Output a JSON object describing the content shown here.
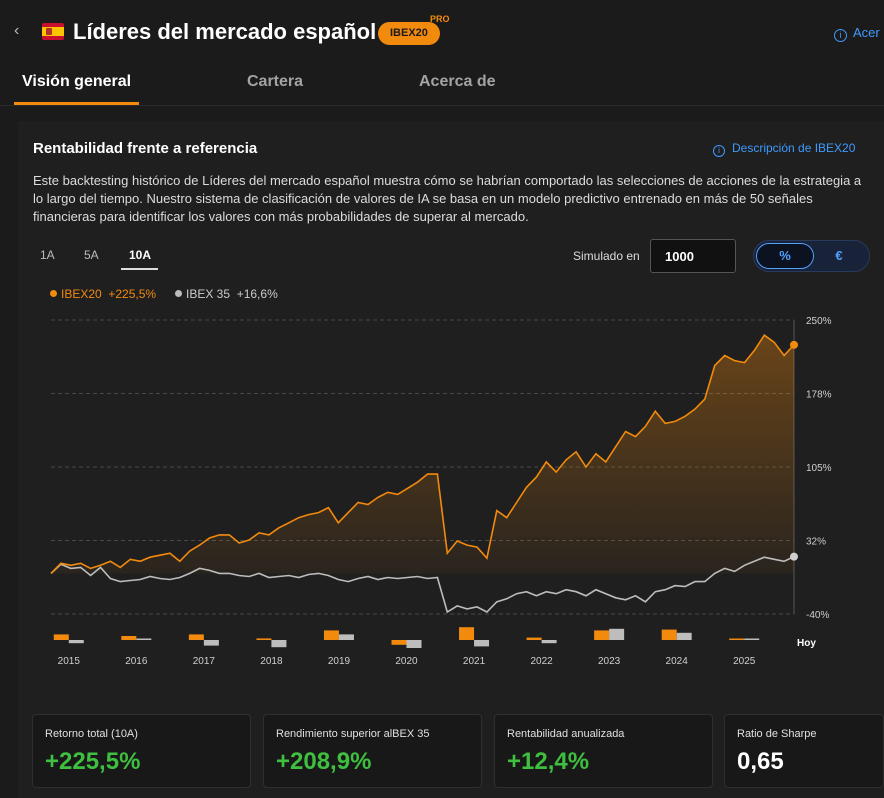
{
  "header": {
    "title": "Líderes del mercado español",
    "badge": "IBEX20",
    "pro": "PRO",
    "about_link": "Acer"
  },
  "tabs": [
    {
      "label": "Visión general",
      "active": true
    },
    {
      "label": "Cartera"
    },
    {
      "label": "Acerca de"
    }
  ],
  "card": {
    "title": "Rentabilidad frente a referencia",
    "desc_link": "Descripción de IBEX20",
    "description": "Este backtesting histórico de Líderes del mercado español muestra cómo se habrían comportado las selecciones de acciones de la estrategia a lo largo del tiempo. Nuestro sistema de clasificación de valores de IA se basa en un modelo predictivo entrenado en más de 50 señales financieras para identificar los valores con más probabilidades de superar al mercado.",
    "ranges": [
      "1A",
      "5A",
      "10A"
    ],
    "active_range": "10A",
    "simulated_label": "Simulado en",
    "simulated_value": "1000",
    "toggle": [
      "%",
      "€"
    ],
    "toggle_active": "%"
  },
  "colors": {
    "strategy": "#f28a0e",
    "benchmark": "#bdbdbd",
    "positive": "#3fbf3f",
    "link": "#3d9bff"
  },
  "chart_data": {
    "type": "line",
    "series": [
      {
        "name": "IBEX20",
        "last": "+225,5%",
        "values": [
          0,
          10,
          8,
          10,
          5,
          8,
          12,
          6,
          14,
          12,
          16,
          18,
          20,
          12,
          22,
          28,
          35,
          38,
          38,
          30,
          33,
          40,
          38,
          45,
          50,
          55,
          58,
          60,
          65,
          50,
          60,
          70,
          68,
          75,
          80,
          78,
          84,
          90,
          98,
          98,
          20,
          32,
          28,
          26,
          15,
          62,
          55,
          70,
          85,
          95,
          110,
          100,
          112,
          120,
          105,
          118,
          110,
          125,
          140,
          135,
          145,
          160,
          148,
          150,
          155,
          162,
          172,
          205,
          215,
          210,
          208,
          220,
          235,
          228,
          215,
          225.5
        ]
      },
      {
        "name": "IBEX 35",
        "last": "+16,6%",
        "values": [
          0,
          9,
          5,
          6,
          -2,
          6,
          -5,
          -8,
          -7,
          -6,
          -3,
          -5,
          -6,
          -4,
          0,
          5,
          3,
          0,
          0,
          -2,
          -3,
          0,
          -4,
          -3,
          -2,
          -4,
          -1,
          0,
          -2,
          -6,
          -8,
          -5,
          -3,
          -6,
          -4,
          -5,
          -4,
          -3,
          -5,
          -4,
          -38,
          -32,
          -35,
          -33,
          -38,
          -28,
          -25,
          -20,
          -18,
          -22,
          -18,
          -20,
          -16,
          -18,
          -22,
          -16,
          -20,
          -24,
          -26,
          -22,
          -28,
          -18,
          -16,
          -12,
          -13,
          -8,
          -8,
          0,
          5,
          2,
          8,
          12,
          16,
          14,
          12,
          16.6
        ]
      }
    ],
    "x_ticks": [
      "2015",
      "2016",
      "2017",
      "2018",
      "2019",
      "2020",
      "2021",
      "2022",
      "2023",
      "2024",
      "2025"
    ],
    "x_end_label": "Hoy",
    "y_ticks": [
      "250%",
      "178%",
      "105%",
      "32%",
      "-40%"
    ],
    "ylim": [
      -40,
      250
    ],
    "annual": {
      "strategy": [
        7,
        5,
        7,
        2,
        12,
        -6,
        16,
        3,
        12,
        13,
        1
      ],
      "benchmark": [
        -4,
        1,
        -7,
        -9,
        7,
        -10,
        -8,
        -4,
        14,
        9,
        1
      ]
    }
  },
  "stats": [
    {
      "label": "Retorno total (10A)",
      "value": "+225,5%",
      "color": "#3fbf3f"
    },
    {
      "label": "Rendimiento superior alBEX 35",
      "value": "+208,9%",
      "color": "#3fbf3f"
    },
    {
      "label": "Rentabilidad anualizada",
      "value": "+12,4%",
      "color": "#3fbf3f"
    },
    {
      "label": "Ratio de Sharpe",
      "value": "0,65",
      "color": "#ffffff"
    }
  ]
}
